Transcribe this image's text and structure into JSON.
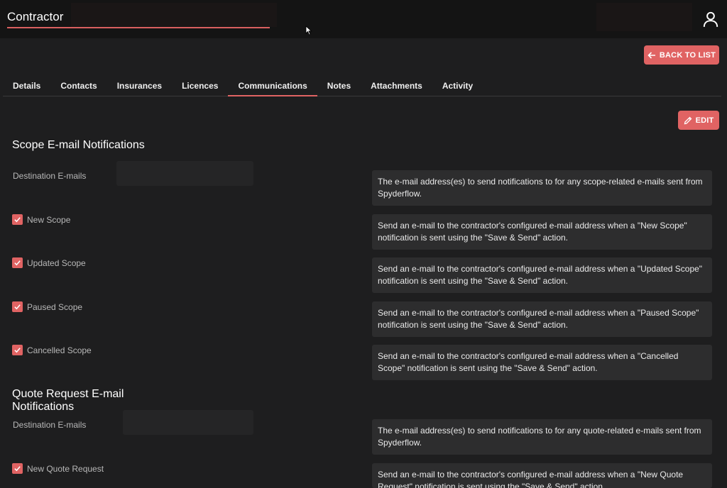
{
  "header": {
    "title": "Contractor"
  },
  "actions": {
    "back_label": "BACK TO LIST",
    "edit_label": "EDIT"
  },
  "tabs": [
    {
      "label": "Details"
    },
    {
      "label": "Contacts"
    },
    {
      "label": "Insurances"
    },
    {
      "label": "Licences"
    },
    {
      "label": "Communications"
    },
    {
      "label": "Notes"
    },
    {
      "label": "Attachments"
    },
    {
      "label": "Activity"
    }
  ],
  "active_tab": "Communications",
  "accent_color": "#e06363",
  "scope": {
    "title": "Scope E-mail Notifications",
    "destination_label": "Destination E-mails",
    "destination_value": "",
    "destination_desc": "The e-mail address(es) to send notifications to for any scope-related e-mails sent from Spyderflow.",
    "items": [
      {
        "label": "New Scope",
        "checked": true,
        "desc": "Send an e-mail to the contractor's configured e-mail address when a \"New Scope\" notification is sent using the \"Save & Send\" action."
      },
      {
        "label": "Updated Scope",
        "checked": true,
        "desc": "Send an e-mail to the contractor's configured e-mail address when a \"Updated Scope\" notification is sent using the \"Save & Send\" action."
      },
      {
        "label": "Paused Scope",
        "checked": true,
        "desc": "Send an e-mail to the contractor's configured e-mail address when a \"Paused Scope\" notification is sent using the \"Save & Send\" action."
      },
      {
        "label": "Cancelled Scope",
        "checked": true,
        "desc": "Send an e-mail to the contractor's configured e-mail address when a \"Cancelled Scope\" notification is sent using the \"Save & Send\" action."
      }
    ]
  },
  "quote": {
    "title_line1": "Quote Request E-mail",
    "title_line2": "Notifications",
    "destination_label": "Destination E-mails",
    "destination_value": "",
    "destination_desc": "The e-mail address(es) to send notifications to for any quote-related e-mails sent from Spyderflow.",
    "items": [
      {
        "label": "New Quote Request",
        "checked": true,
        "desc": "Send an e-mail to the contractor's configured e-mail address when a \"New Quote Request\" notification is sent using the \"Save & Send\" action."
      }
    ]
  }
}
